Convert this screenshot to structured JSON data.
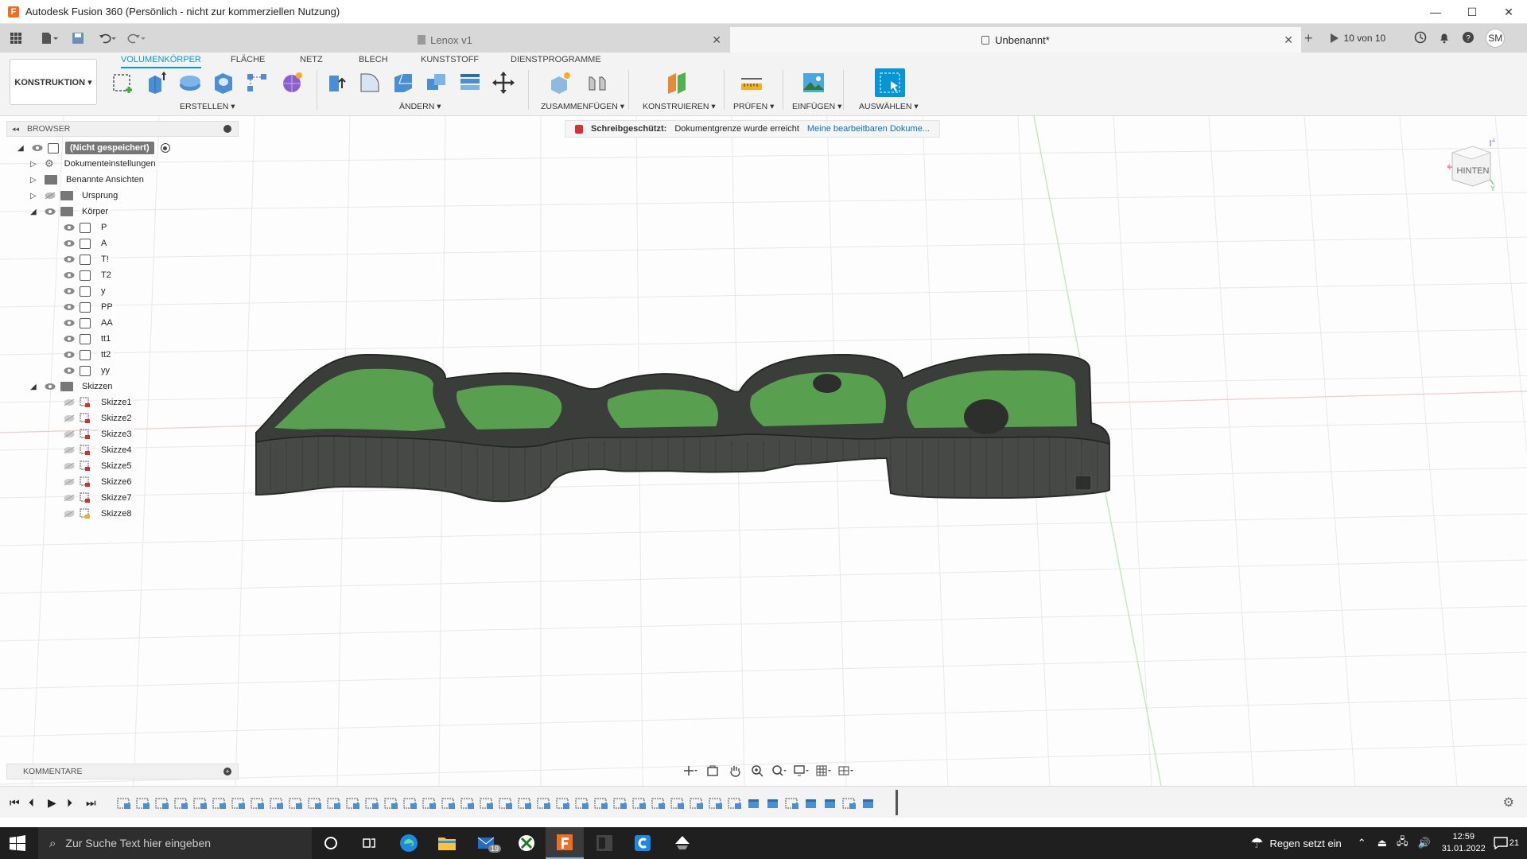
{
  "window": {
    "app_icon_letter": "F",
    "title": "Autodesk Fusion 360 (Persönlich - nicht zur kommerziellen Nutzung)",
    "min": "—",
    "max": "☐",
    "close": "✕"
  },
  "tabs": {
    "tab1": "Lenox v1",
    "tab2": "Unbenannt*",
    "close": "✕",
    "jobs": "10 von 10",
    "user_initials": "SM"
  },
  "ribbon": {
    "workspace": "KONSTRUKTION ▾",
    "tabs": [
      "VOLUMENKÖRPER",
      "FLÄCHE",
      "NETZ",
      "BLECH",
      "KUNSTSTOFF",
      "DIENSTPROGRAMME"
    ],
    "groups": {
      "create": "ERSTELLEN ▾",
      "modify": "ÄNDERN ▾",
      "assemble": "ZUSAMMENFÜGEN ▾",
      "construct": "KONSTRUIEREN ▾",
      "inspect": "PRÜFEN ▾",
      "insert": "EINFÜGEN ▾",
      "select": "AUSWÄHLEN ▾"
    }
  },
  "browser": {
    "header": "BROWSER",
    "root": "(Nicht gespeichert)",
    "doc_settings": "Dokumenteinstellungen",
    "named_views": "Benannte Ansichten",
    "origin": "Ursprung",
    "bodies_folder": "Körper",
    "bodies": [
      "P",
      "A",
      "T!",
      "T2",
      "y",
      "PP",
      "AA",
      "tt1",
      "tt2",
      "yy"
    ],
    "sketches_folder": "Skizzen",
    "sketches": [
      "Skizze1",
      "Skizze2",
      "Skizze3",
      "Skizze4",
      "Skizze5",
      "Skizze6",
      "Skizze7",
      "Skizze8"
    ]
  },
  "notice": {
    "label": "Schreibgeschützt:",
    "message": "Dokumentgrenze wurde erreicht",
    "link": "Meine bearbeitbaren Dokume..."
  },
  "viewcube": {
    "face": "HINTEN",
    "axis_z": "Z",
    "axis_x": "X",
    "axis_y": "Y"
  },
  "comments": {
    "label": "KOMMENTARE",
    "plus": "+"
  },
  "timeline": {
    "gear": "⚙"
  },
  "taskbar": {
    "search_placeholder": "Zur Suche Text hier eingeben",
    "mail_badge": "19",
    "weather": "Regen setzt ein",
    "time": "12:59",
    "date": "31.01.2022",
    "notifications": "21"
  },
  "colors": {
    "accent": "#0696d7",
    "model_wall": "#4a4d4a",
    "model_floor": "#4f9a49",
    "taskbar": "#1f1f1f"
  }
}
